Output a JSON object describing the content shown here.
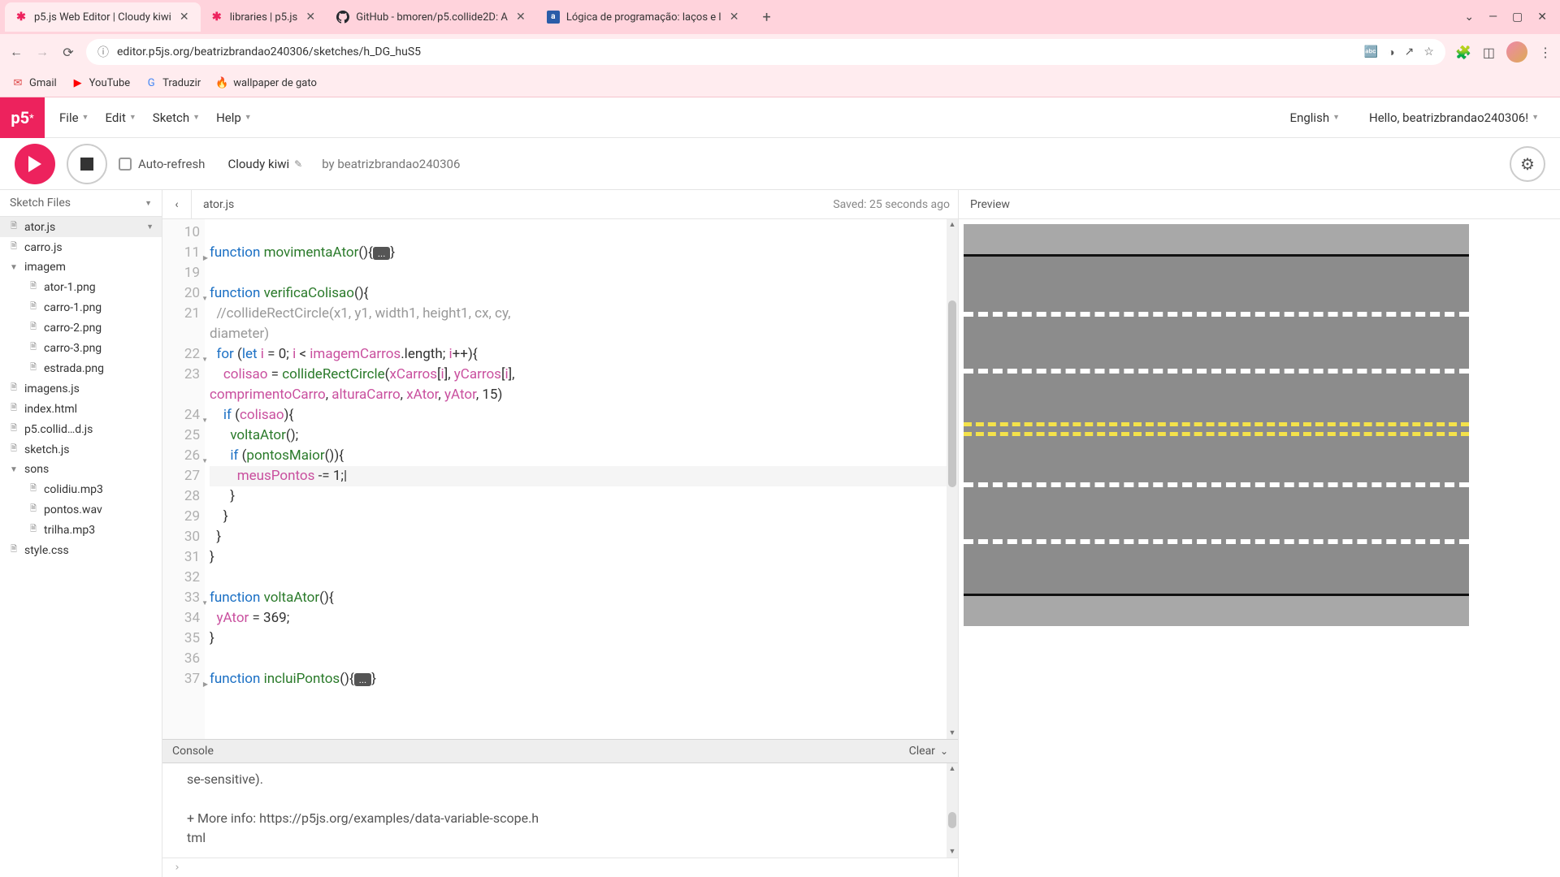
{
  "browser": {
    "tabs": [
      {
        "title": "p5.js Web Editor | Cloudy kiwi",
        "icon": "p5"
      },
      {
        "title": "libraries | p5.js",
        "icon": "p5"
      },
      {
        "title": "GitHub - bmoren/p5.collide2D: A",
        "icon": "github"
      },
      {
        "title": "Lógica de programação: laços e l",
        "icon": "alura"
      }
    ],
    "url": "editor.p5js.org/beatrizbrandao240306/sketches/h_DG_huS5",
    "bookmarks": [
      {
        "label": "Gmail",
        "icon": "M"
      },
      {
        "label": "YouTube",
        "icon": "▶"
      },
      {
        "label": "Traduzir",
        "icon": "G"
      },
      {
        "label": "wallpaper de gato",
        "icon": "🔥"
      }
    ]
  },
  "app": {
    "menus": [
      "File",
      "Edit",
      "Sketch",
      "Help"
    ],
    "language": "English",
    "greeting": "Hello, beatrizbrandao240306!",
    "autoRefresh": "Auto-refresh",
    "sketchName": "Cloudy kiwi",
    "byline": "by beatrizbrandao240306"
  },
  "sidebar": {
    "header": "Sketch Files",
    "files": [
      {
        "name": "ator.js",
        "type": "file",
        "active": true,
        "opts": true
      },
      {
        "name": "carro.js",
        "type": "file"
      },
      {
        "name": "imagem",
        "type": "folder",
        "open": true
      },
      {
        "name": "ator-1.png",
        "type": "file",
        "indent": true
      },
      {
        "name": "carro-1.png",
        "type": "file",
        "indent": true
      },
      {
        "name": "carro-2.png",
        "type": "file",
        "indent": true
      },
      {
        "name": "carro-3.png",
        "type": "file",
        "indent": true
      },
      {
        "name": "estrada.png",
        "type": "file",
        "indent": true
      },
      {
        "name": "imagens.js",
        "type": "file"
      },
      {
        "name": "index.html",
        "type": "file"
      },
      {
        "name": "p5.collid…d.js",
        "type": "file"
      },
      {
        "name": "sketch.js",
        "type": "file"
      },
      {
        "name": "sons",
        "type": "folder",
        "open": true
      },
      {
        "name": "colidiu.mp3",
        "type": "file",
        "indent": true
      },
      {
        "name": "pontos.wav",
        "type": "file",
        "indent": true
      },
      {
        "name": "trilha.mp3",
        "type": "file",
        "indent": true
      },
      {
        "name": "style.css",
        "type": "file"
      }
    ]
  },
  "editor": {
    "filename": "ator.js",
    "saved": "Saved: 25 seconds ago",
    "startLine": 10,
    "highlightedLine": 27
  },
  "console": {
    "title": "Console",
    "clear": "Clear",
    "lines": [
      "se-sensitive).",
      "",
      "+ More info: https://p5js.org/examples/data-variable-scope.h",
      "tml"
    ]
  },
  "preview": {
    "title": "Preview"
  }
}
